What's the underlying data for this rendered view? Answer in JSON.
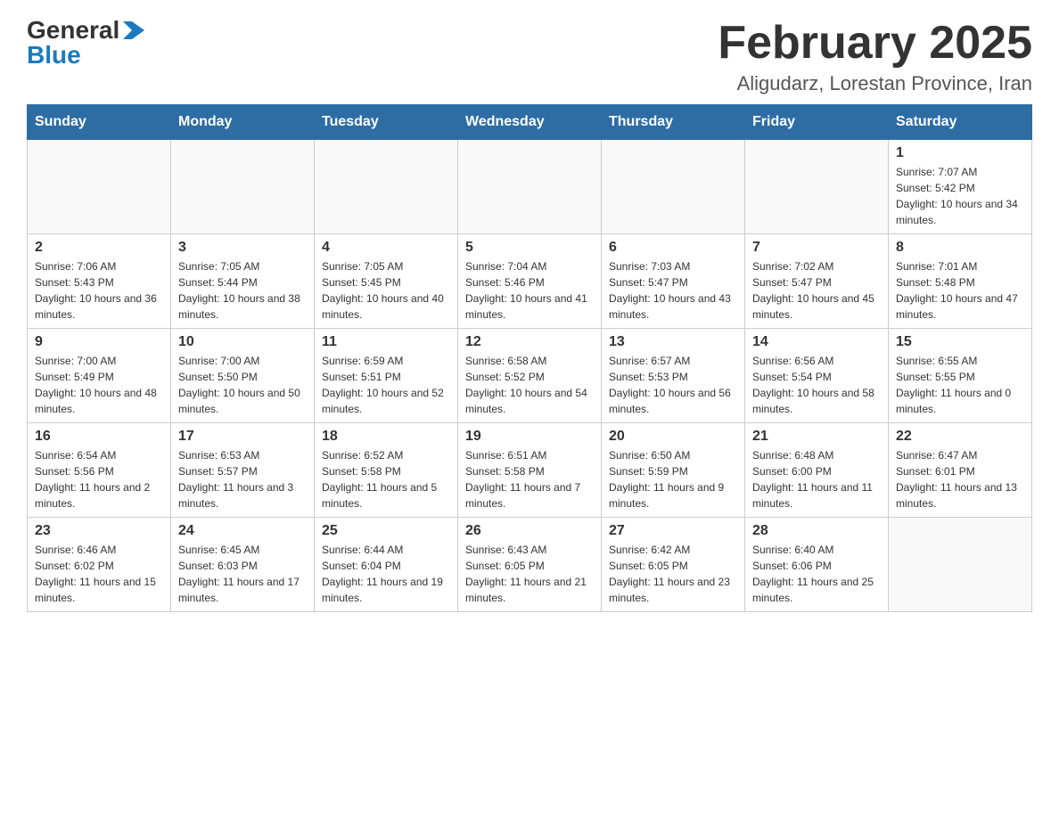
{
  "header": {
    "logo_general": "General",
    "logo_blue": "Blue",
    "month_title": "February 2025",
    "location": "Aligudarz, Lorestan Province, Iran"
  },
  "weekdays": [
    "Sunday",
    "Monday",
    "Tuesday",
    "Wednesday",
    "Thursday",
    "Friday",
    "Saturday"
  ],
  "weeks": [
    [
      {
        "day": "",
        "sunrise": "",
        "sunset": "",
        "daylight": ""
      },
      {
        "day": "",
        "sunrise": "",
        "sunset": "",
        "daylight": ""
      },
      {
        "day": "",
        "sunrise": "",
        "sunset": "",
        "daylight": ""
      },
      {
        "day": "",
        "sunrise": "",
        "sunset": "",
        "daylight": ""
      },
      {
        "day": "",
        "sunrise": "",
        "sunset": "",
        "daylight": ""
      },
      {
        "day": "",
        "sunrise": "",
        "sunset": "",
        "daylight": ""
      },
      {
        "day": "1",
        "sunrise": "Sunrise: 7:07 AM",
        "sunset": "Sunset: 5:42 PM",
        "daylight": "Daylight: 10 hours and 34 minutes."
      }
    ],
    [
      {
        "day": "2",
        "sunrise": "Sunrise: 7:06 AM",
        "sunset": "Sunset: 5:43 PM",
        "daylight": "Daylight: 10 hours and 36 minutes."
      },
      {
        "day": "3",
        "sunrise": "Sunrise: 7:05 AM",
        "sunset": "Sunset: 5:44 PM",
        "daylight": "Daylight: 10 hours and 38 minutes."
      },
      {
        "day": "4",
        "sunrise": "Sunrise: 7:05 AM",
        "sunset": "Sunset: 5:45 PM",
        "daylight": "Daylight: 10 hours and 40 minutes."
      },
      {
        "day": "5",
        "sunrise": "Sunrise: 7:04 AM",
        "sunset": "Sunset: 5:46 PM",
        "daylight": "Daylight: 10 hours and 41 minutes."
      },
      {
        "day": "6",
        "sunrise": "Sunrise: 7:03 AM",
        "sunset": "Sunset: 5:47 PM",
        "daylight": "Daylight: 10 hours and 43 minutes."
      },
      {
        "day": "7",
        "sunrise": "Sunrise: 7:02 AM",
        "sunset": "Sunset: 5:47 PM",
        "daylight": "Daylight: 10 hours and 45 minutes."
      },
      {
        "day": "8",
        "sunrise": "Sunrise: 7:01 AM",
        "sunset": "Sunset: 5:48 PM",
        "daylight": "Daylight: 10 hours and 47 minutes."
      }
    ],
    [
      {
        "day": "9",
        "sunrise": "Sunrise: 7:00 AM",
        "sunset": "Sunset: 5:49 PM",
        "daylight": "Daylight: 10 hours and 48 minutes."
      },
      {
        "day": "10",
        "sunrise": "Sunrise: 7:00 AM",
        "sunset": "Sunset: 5:50 PM",
        "daylight": "Daylight: 10 hours and 50 minutes."
      },
      {
        "day": "11",
        "sunrise": "Sunrise: 6:59 AM",
        "sunset": "Sunset: 5:51 PM",
        "daylight": "Daylight: 10 hours and 52 minutes."
      },
      {
        "day": "12",
        "sunrise": "Sunrise: 6:58 AM",
        "sunset": "Sunset: 5:52 PM",
        "daylight": "Daylight: 10 hours and 54 minutes."
      },
      {
        "day": "13",
        "sunrise": "Sunrise: 6:57 AM",
        "sunset": "Sunset: 5:53 PM",
        "daylight": "Daylight: 10 hours and 56 minutes."
      },
      {
        "day": "14",
        "sunrise": "Sunrise: 6:56 AM",
        "sunset": "Sunset: 5:54 PM",
        "daylight": "Daylight: 10 hours and 58 minutes."
      },
      {
        "day": "15",
        "sunrise": "Sunrise: 6:55 AM",
        "sunset": "Sunset: 5:55 PM",
        "daylight": "Daylight: 11 hours and 0 minutes."
      }
    ],
    [
      {
        "day": "16",
        "sunrise": "Sunrise: 6:54 AM",
        "sunset": "Sunset: 5:56 PM",
        "daylight": "Daylight: 11 hours and 2 minutes."
      },
      {
        "day": "17",
        "sunrise": "Sunrise: 6:53 AM",
        "sunset": "Sunset: 5:57 PM",
        "daylight": "Daylight: 11 hours and 3 minutes."
      },
      {
        "day": "18",
        "sunrise": "Sunrise: 6:52 AM",
        "sunset": "Sunset: 5:58 PM",
        "daylight": "Daylight: 11 hours and 5 minutes."
      },
      {
        "day": "19",
        "sunrise": "Sunrise: 6:51 AM",
        "sunset": "Sunset: 5:58 PM",
        "daylight": "Daylight: 11 hours and 7 minutes."
      },
      {
        "day": "20",
        "sunrise": "Sunrise: 6:50 AM",
        "sunset": "Sunset: 5:59 PM",
        "daylight": "Daylight: 11 hours and 9 minutes."
      },
      {
        "day": "21",
        "sunrise": "Sunrise: 6:48 AM",
        "sunset": "Sunset: 6:00 PM",
        "daylight": "Daylight: 11 hours and 11 minutes."
      },
      {
        "day": "22",
        "sunrise": "Sunrise: 6:47 AM",
        "sunset": "Sunset: 6:01 PM",
        "daylight": "Daylight: 11 hours and 13 minutes."
      }
    ],
    [
      {
        "day": "23",
        "sunrise": "Sunrise: 6:46 AM",
        "sunset": "Sunset: 6:02 PM",
        "daylight": "Daylight: 11 hours and 15 minutes."
      },
      {
        "day": "24",
        "sunrise": "Sunrise: 6:45 AM",
        "sunset": "Sunset: 6:03 PM",
        "daylight": "Daylight: 11 hours and 17 minutes."
      },
      {
        "day": "25",
        "sunrise": "Sunrise: 6:44 AM",
        "sunset": "Sunset: 6:04 PM",
        "daylight": "Daylight: 11 hours and 19 minutes."
      },
      {
        "day": "26",
        "sunrise": "Sunrise: 6:43 AM",
        "sunset": "Sunset: 6:05 PM",
        "daylight": "Daylight: 11 hours and 21 minutes."
      },
      {
        "day": "27",
        "sunrise": "Sunrise: 6:42 AM",
        "sunset": "Sunset: 6:05 PM",
        "daylight": "Daylight: 11 hours and 23 minutes."
      },
      {
        "day": "28",
        "sunrise": "Sunrise: 6:40 AM",
        "sunset": "Sunset: 6:06 PM",
        "daylight": "Daylight: 11 hours and 25 minutes."
      },
      {
        "day": "",
        "sunrise": "",
        "sunset": "",
        "daylight": ""
      }
    ]
  ]
}
